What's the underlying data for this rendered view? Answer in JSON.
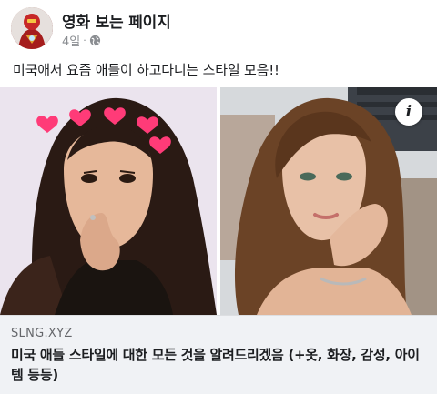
{
  "post": {
    "page_name": "영화 보는 페이지",
    "time": "4일",
    "separator": "·",
    "privacy_icon": "globe-icon",
    "caption": "미국애서 요즘 애들이 하고다니는 스타일 모음!!"
  },
  "media": {
    "left_photo": "woman-with-heart-crown-filter",
    "right_photo": "woman-with-curly-hair",
    "info_icon": "info-icon",
    "info_label": "i"
  },
  "link": {
    "domain": "SLNG.XYZ",
    "title": "미국 애들 스타일에 대한 모든 것을 알려드리겠음 (+옷, 화장, 감성, 아이템 등등)"
  }
}
